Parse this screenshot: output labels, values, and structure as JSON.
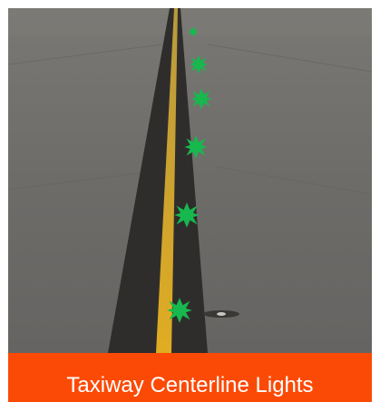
{
  "caption": {
    "text": "Taxiway Centerline Lights"
  },
  "colors": {
    "caption_background": "#fb4a06",
    "caption_text": "#ffffff",
    "light_color": "#17b84e",
    "centerline_paint": "#d4a62a",
    "pavement": "#6f6d6a",
    "sealant": "#2e2c2b"
  },
  "scene": {
    "subject": "taxiway-pavement-photo",
    "icons": [
      "taxiway-centerline-light-icon",
      "in-pavement-light-fixture-icon"
    ]
  }
}
